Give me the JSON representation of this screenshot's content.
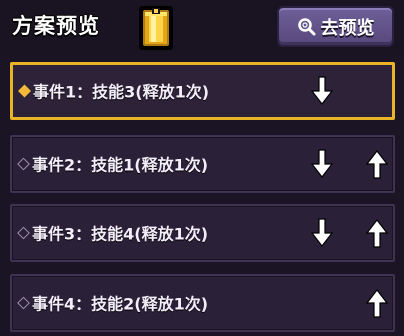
{
  "header": {
    "title": "方案预览",
    "icon": "gold-bar-icon",
    "preview_button_label": "去预览",
    "preview_button_icon": "search-icon"
  },
  "colors": {
    "background": "#1b1424",
    "row_background": "#2a2038",
    "selected_border": "#e9b526",
    "button": "#65558d"
  },
  "events": [
    {
      "label": "事件1：技能3(释放1次)",
      "selected": true,
      "down": true,
      "up": false
    },
    {
      "label": "事件2：技能1(释放1次)",
      "selected": false,
      "down": true,
      "up": true
    },
    {
      "label": "事件3：技能4(释放1次)",
      "selected": false,
      "down": true,
      "up": true
    },
    {
      "label": "事件4：技能2(释放1次)",
      "selected": false,
      "down": false,
      "up": true
    }
  ]
}
